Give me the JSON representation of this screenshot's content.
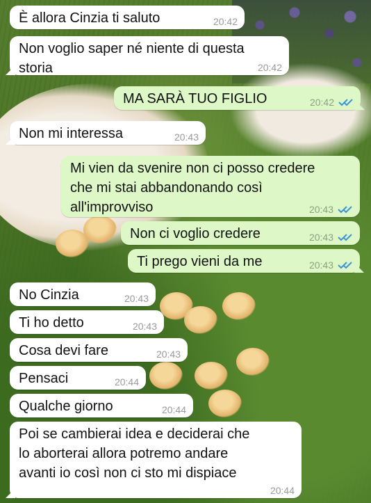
{
  "chat": {
    "messages": [
      {
        "dir": "in",
        "text": "È allora Cinzia ti saluto",
        "time": "20:42"
      },
      {
        "dir": "in",
        "text": "Non voglio saper né niente di questa\nstoria",
        "time": "20:42"
      },
      {
        "dir": "out",
        "text": "MA SARÀ TUO FIGLIO",
        "time": "20:42",
        "ticks": "read"
      },
      {
        "dir": "in",
        "text": "Non mi interessa",
        "time": "20:43"
      },
      {
        "dir": "out",
        "text": "Mi vien da svenire non ci posso credere\nche mi stai abbandonando così\nall'improvviso",
        "time": "20:43",
        "ticks": "read"
      },
      {
        "dir": "out",
        "text": "Non ci voglio credere",
        "time": "20:43",
        "ticks": "read"
      },
      {
        "dir": "out",
        "text": "Ti prego vieni da me",
        "time": "20:43",
        "ticks": "read"
      },
      {
        "dir": "in",
        "text": "No Cinzia",
        "time": "20:43"
      },
      {
        "dir": "in",
        "text": "Ti ho detto",
        "time": "20:43"
      },
      {
        "dir": "in",
        "text": "Cosa devi fare",
        "time": "20:43"
      },
      {
        "dir": "in",
        "text": "Pensaci",
        "time": "20:44"
      },
      {
        "dir": "in",
        "text": "Qualche giorno",
        "time": "20:44"
      },
      {
        "dir": "in",
        "text": "Poi se cambierai idea e deciderai che\nlo aborterai allora potremo andare\navanti io così non ci sto mi dispiace",
        "time": "20:44"
      }
    ]
  },
  "colors": {
    "incoming_bubble": "#ffffff",
    "outgoing_bubble": "#ddf8c6",
    "read_ticks": "#3b93d8",
    "timestamp": "#9a9a9a"
  },
  "icons": {
    "read_receipt": "double-check-icon"
  }
}
